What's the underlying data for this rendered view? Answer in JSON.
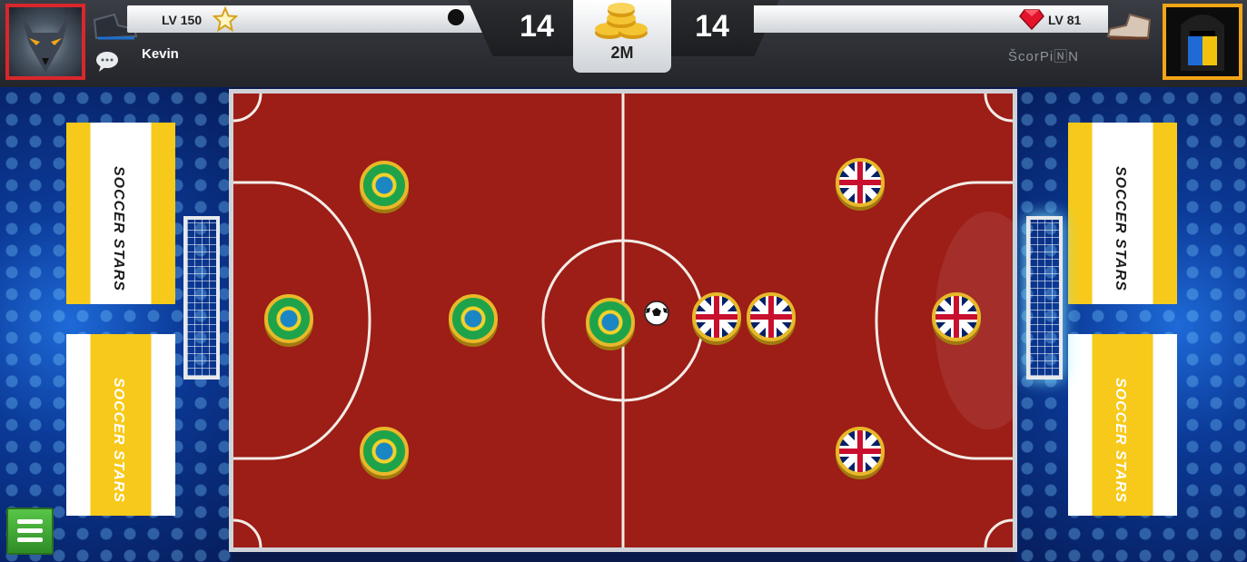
{
  "hud": {
    "player1": {
      "level": "LV 150",
      "name": "Kevin"
    },
    "player2": {
      "level": "LV 81",
      "name": "ŠcorPi🄽N"
    },
    "score_left": "14",
    "score_right": "14",
    "pot": "2M"
  },
  "banners": {
    "text": "SOCCER STARS"
  },
  "colors": {
    "field": "#9d1d17",
    "accent_yellow": "#f7c91a",
    "p1_frame": "#d8272c",
    "p2_frame": "#f2a516"
  },
  "icons": [
    "star-icon",
    "chat-icon",
    "coin-stack-icon",
    "gem-icon",
    "boot-icon",
    "menu-icon"
  ]
}
